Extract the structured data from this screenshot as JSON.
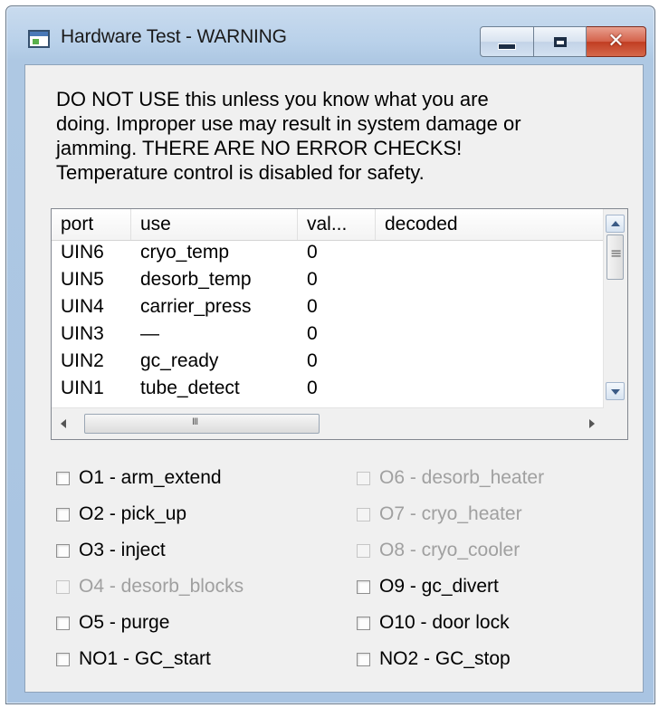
{
  "window": {
    "title": "Hardware Test - WARNING",
    "close_glyph": "✕"
  },
  "warning_text": "DO NOT USE this unless you know what you are\ndoing.  Improper use may result in system damage or\njamming.  THERE ARE NO ERROR CHECKS!\nTemperature control is disabled for safety.",
  "table": {
    "columns": [
      "port",
      "use",
      "val...",
      "decoded"
    ],
    "rows": [
      {
        "port": "UIN6",
        "use": "cryo_temp",
        "value": "0",
        "decoded": ""
      },
      {
        "port": "UIN5",
        "use": "desorb_temp",
        "value": "0",
        "decoded": ""
      },
      {
        "port": "UIN4",
        "use": "carrier_press",
        "value": "0",
        "decoded": ""
      },
      {
        "port": "UIN3",
        "use": "—",
        "value": "0",
        "decoded": ""
      },
      {
        "port": "UIN2",
        "use": "gc_ready",
        "value": "0",
        "decoded": ""
      },
      {
        "port": "UIN1",
        "use": "tube_detect",
        "value": "0",
        "decoded": ""
      }
    ]
  },
  "outputs": {
    "left": [
      {
        "label": "O1 - arm_extend",
        "checked": false,
        "enabled": true
      },
      {
        "label": "O2 - pick_up",
        "checked": false,
        "enabled": true
      },
      {
        "label": "O3 - inject",
        "checked": false,
        "enabled": true
      },
      {
        "label": "O4 - desorb_blocks",
        "checked": false,
        "enabled": false
      },
      {
        "label": "O5 - purge",
        "checked": false,
        "enabled": true
      },
      {
        "label": "NO1 - GC_start",
        "checked": false,
        "enabled": true
      }
    ],
    "right": [
      {
        "label": "O6 - desorb_heater",
        "checked": false,
        "enabled": false
      },
      {
        "label": "O7 - cryo_heater",
        "checked": false,
        "enabled": false
      },
      {
        "label": "O8 - cryo_cooler",
        "checked": false,
        "enabled": false
      },
      {
        "label": "O9 - gc_divert",
        "checked": false,
        "enabled": true
      },
      {
        "label": "O10 - door lock",
        "checked": false,
        "enabled": true
      },
      {
        "label": "NO2 - GC_stop",
        "checked": false,
        "enabled": true
      }
    ]
  }
}
